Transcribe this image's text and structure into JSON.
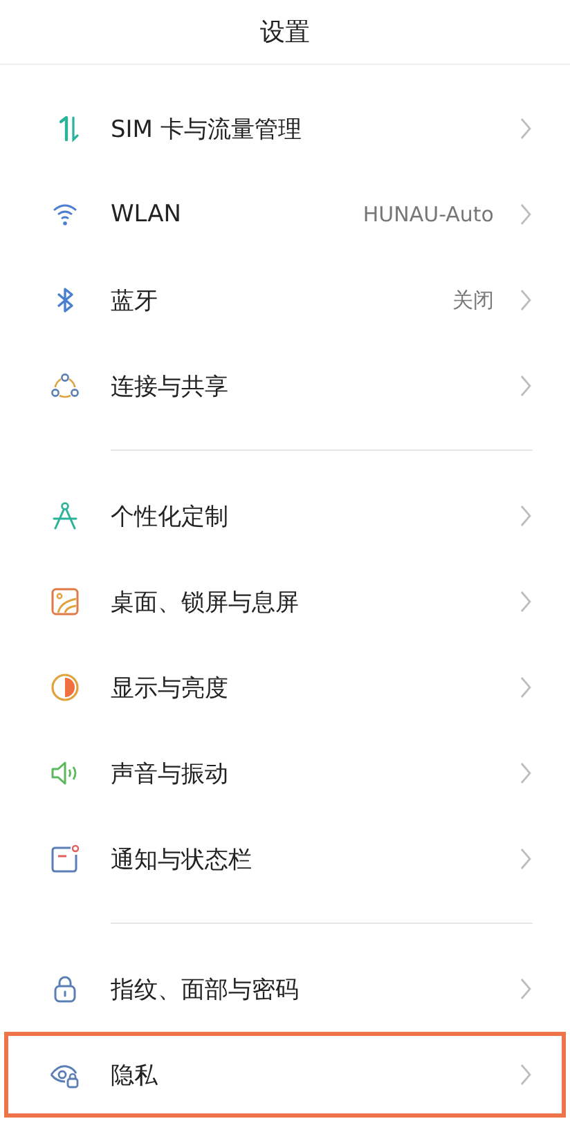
{
  "title": "设置",
  "sections": [
    {
      "items": [
        {
          "label": "SIM 卡与流量管理",
          "highlighted": false
        },
        {
          "label": "WLAN",
          "value": "HUNAU-Auto",
          "highlighted": false
        },
        {
          "label": "蓝牙",
          "value": "关闭",
          "highlighted": false
        },
        {
          "label": "连接与共享",
          "highlighted": false
        }
      ]
    },
    {
      "items": [
        {
          "label": "个性化定制",
          "highlighted": false
        },
        {
          "label": "桌面、锁屏与息屏",
          "highlighted": false
        },
        {
          "label": "显示与亮度",
          "highlighted": false
        },
        {
          "label": "声音与振动",
          "highlighted": false
        },
        {
          "label": "通知与状态栏",
          "highlighted": false
        }
      ]
    },
    {
      "items": [
        {
          "label": "指纹、面部与密码",
          "highlighted": false
        },
        {
          "label": "隐私",
          "highlighted": true
        }
      ]
    }
  ]
}
